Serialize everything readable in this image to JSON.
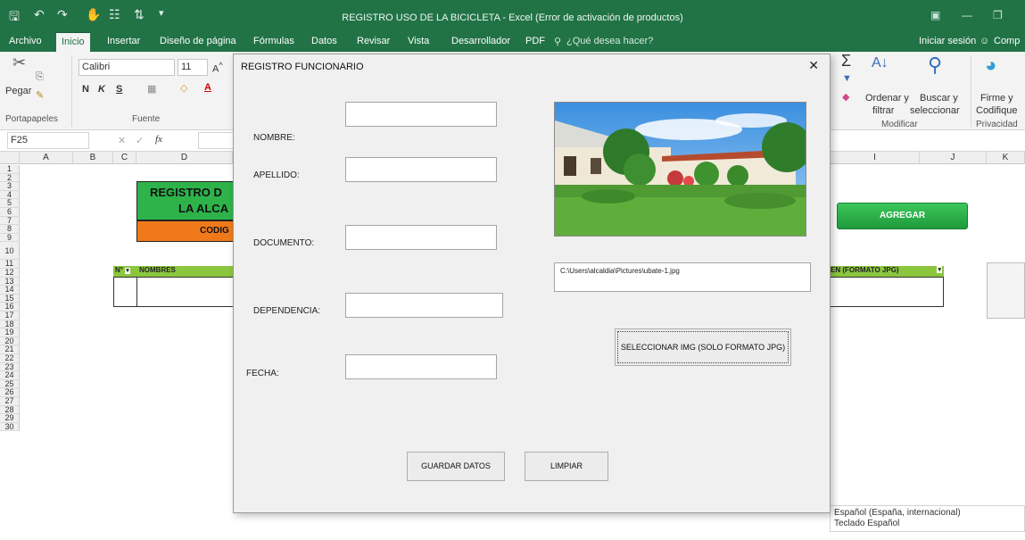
{
  "window": {
    "title": "REGISTRO USO DE LA BICICLETA - Excel (Error de activación de productos)"
  },
  "ribbon_tabs": [
    {
      "label": "Archivo"
    },
    {
      "label": "Inicio"
    },
    {
      "label": "Insertar"
    },
    {
      "label": "Diseño de página"
    },
    {
      "label": "Fórmulas"
    },
    {
      "label": "Datos"
    },
    {
      "label": "Revisar"
    },
    {
      "label": "Vista"
    },
    {
      "label": "Desarrollador"
    },
    {
      "label": "PDF"
    }
  ],
  "tell_me": "¿Qué desea hacer?",
  "account": {
    "sign_in": "Iniciar sesión",
    "share": "Comp"
  },
  "ribbon": {
    "paste": "Pegar",
    "clipboard_group": "Portapapeles",
    "font_name": "Calibri",
    "font_size": "11",
    "font_group": "Fuente",
    "bold": "N",
    "italic": "K",
    "underline": "S",
    "sort_filter_1": "Ordenar y",
    "sort_filter_2": "filtrar",
    "find_select_1": "Buscar y",
    "find_select_2": "seleccionar",
    "modify_group": "Modificar",
    "sign_1": "Firme y",
    "sign_2": "Codifique",
    "privacy_group": "Privacidad"
  },
  "formula_bar": {
    "name_box": "F25",
    "fx": "fx"
  },
  "sheet": {
    "columns": [
      "A",
      "B",
      "C",
      "D",
      "I",
      "J",
      "K"
    ],
    "rows": [
      "1",
      "2",
      "3",
      "4",
      "5",
      "6",
      "7",
      "8",
      "9",
      "10",
      "11",
      "12",
      "13",
      "14",
      "15",
      "16",
      "17",
      "18",
      "19",
      "20",
      "21",
      "22",
      "23",
      "24",
      "25",
      "26",
      "27",
      "28",
      "29",
      "30"
    ],
    "banner_line1": "REGISTRO D",
    "banner_line2": "LA ALCA",
    "banner_code": "CODIG",
    "table_header_no": "N°",
    "table_header_nombres": "NOMBRES",
    "table_header_imagen": "EN (FORMATO JPG)",
    "add_button": "AGREGAR"
  },
  "status_tooltip": {
    "line1": "Español (España, internacional)",
    "line2": "Teclado Español"
  },
  "dialog": {
    "title": "REGISTRO FUNCIONARIO",
    "close": "✕",
    "labels": {
      "nombre": "NOMBRE:",
      "apellido": "APELLIDO:",
      "documento": "DOCUMENTO:",
      "dependencia": "DEPENDENCIA:",
      "fecha": "FECHA:"
    },
    "image_path": "C:\\Users\\alcaldia\\Pictures\\ubate-1.jpg",
    "select_image_button": "SELECCIONAR IMG (SOLO FORMATO JPG)",
    "save_button": "GUARDAR DATOS",
    "clear_button": "LIMPIAR"
  },
  "colors": {
    "excel_green": "#217346",
    "banner_green": "#2db34a",
    "banner_orange": "#f07a1a",
    "table_header_green": "#8cc63f"
  }
}
